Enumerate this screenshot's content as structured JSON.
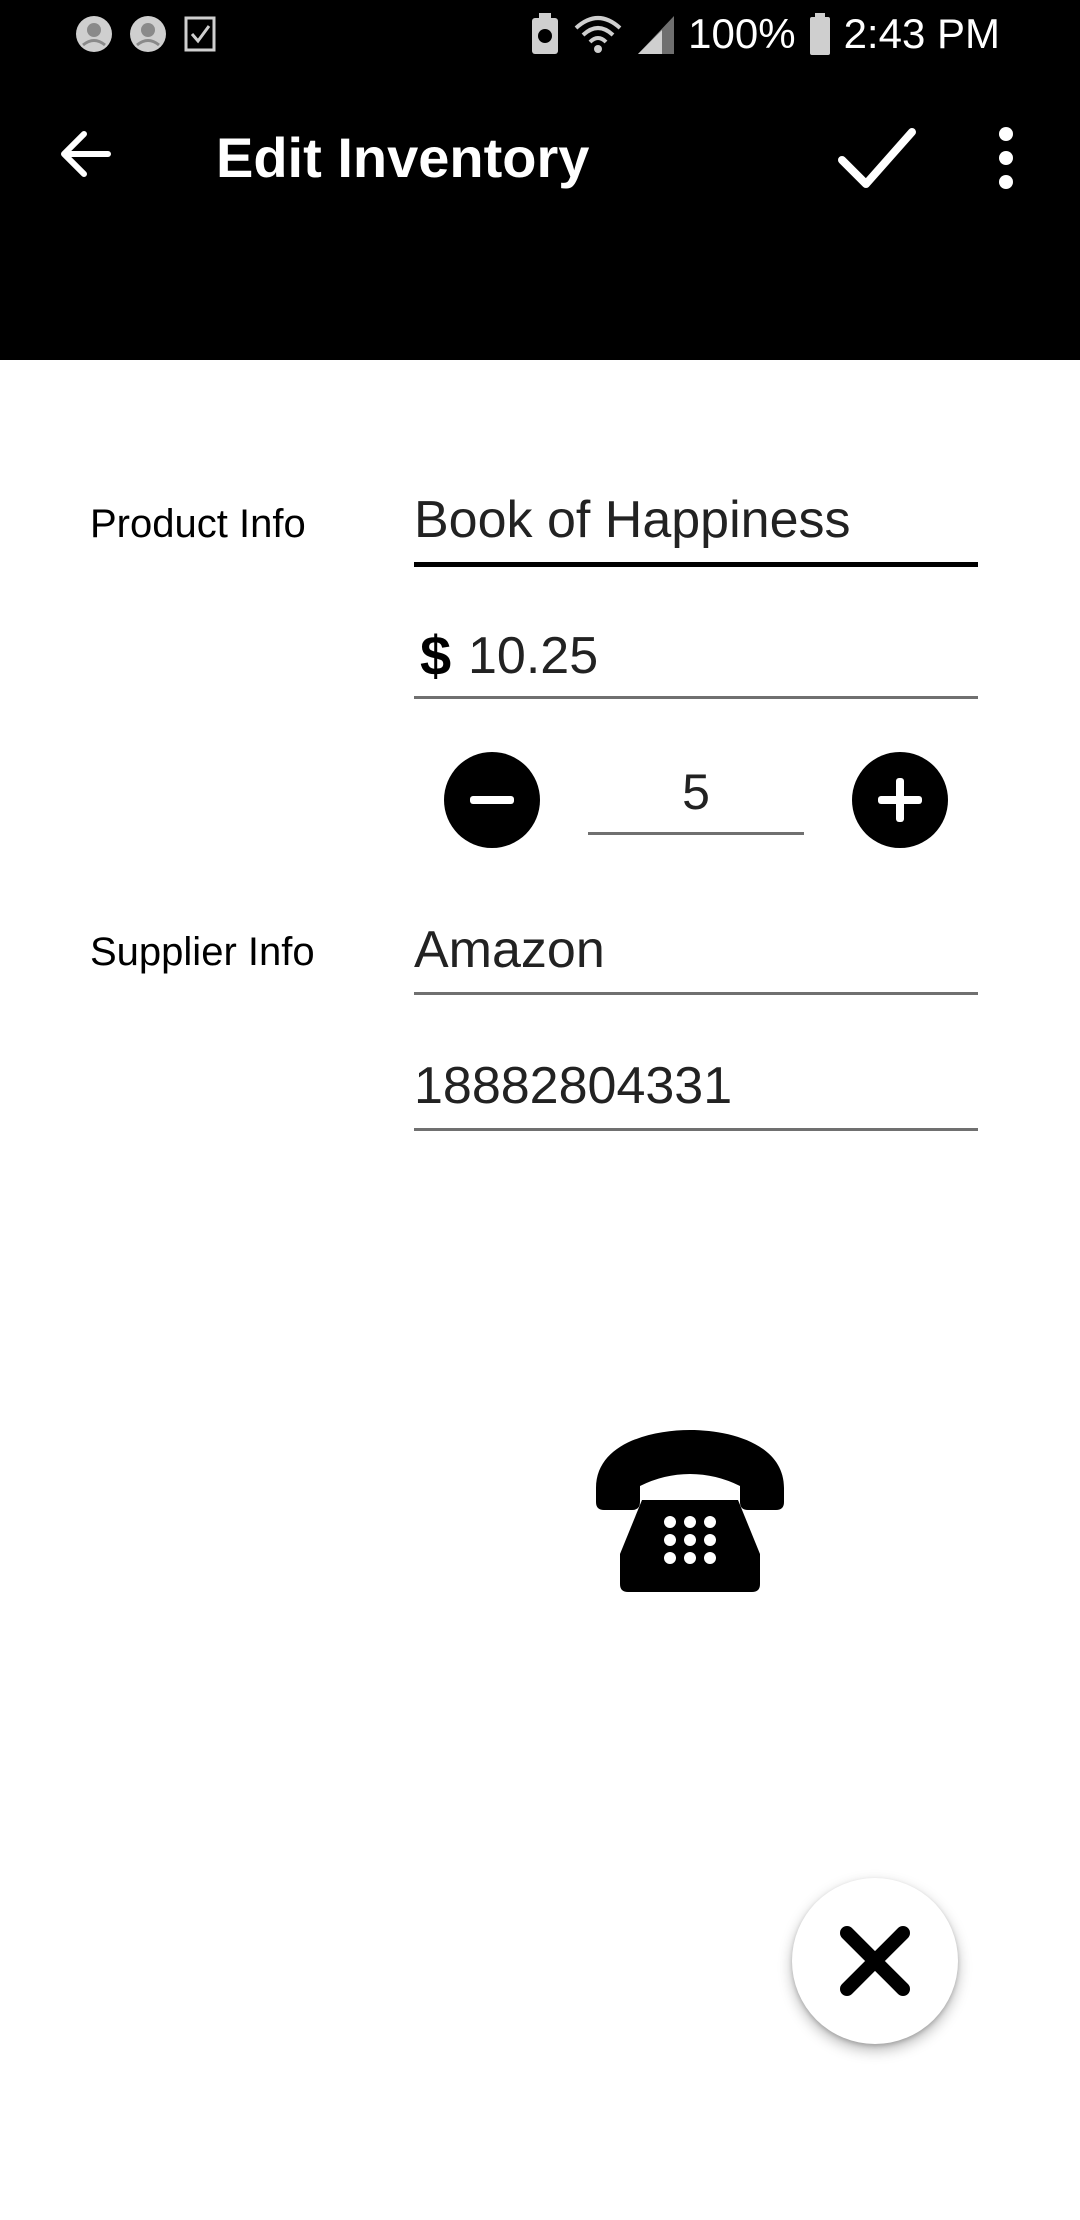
{
  "status_bar": {
    "battery_percent": "100%",
    "time": "2:43 PM"
  },
  "app_bar": {
    "title": "Edit Inventory"
  },
  "product": {
    "label": "Product Info",
    "name": "Book of Happiness",
    "currency_symbol": "$",
    "price": "10.25",
    "quantity": "5"
  },
  "supplier": {
    "label": "Supplier Info",
    "name": "Amazon",
    "phone": "18882804331"
  },
  "colors": {
    "app_bar_bg": "#000000",
    "underline": "#707070",
    "active_underline": "#000000"
  },
  "icons": {
    "back": "arrow-left-icon",
    "save": "check-icon",
    "overflow": "more-vert-icon",
    "decrement": "minus-circle-icon",
    "increment": "plus-circle-icon",
    "call": "telephone-icon",
    "delete": "close-icon"
  }
}
